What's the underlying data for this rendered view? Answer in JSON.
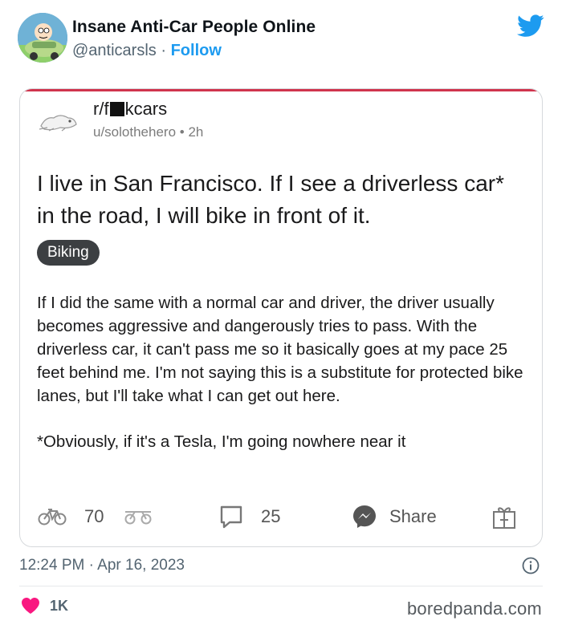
{
  "tweet": {
    "display_name": "Insane Anti-Car People Online",
    "handle": "@anticarsls",
    "separator": "·",
    "follow_label": "Follow",
    "avatar_icon": "cartoon-character-in-car-avatar",
    "platform_icon": "twitter-bird-icon",
    "timestamp": "12:24 PM · Apr 16, 2023",
    "like_count": "1K",
    "like_icon": "heart-icon",
    "info_icon": "info-icon"
  },
  "embedded_post": {
    "subreddit_prefix": "r/f",
    "subreddit_suffix": "kcars",
    "user": "u/solothehero",
    "dot": "•",
    "age": "2h",
    "title": "I live in San Francisco. If I see a driverless car* in the road, I will bike in front of it.",
    "flair": "Biking",
    "paragraphs": [
      "If I did the same with a normal car and driver, the driver usually becomes aggressive and dangerously tries to pass. With the driverless car, it can't pass me so it basically goes at my pace 25 feet behind me. I'm not saying this is a substitute for protected bike lanes, but I'll take what I can get out here.",
      "*Obviously, if it's a Tesla, I'm going nowhere near it"
    ],
    "upvote_count": "70",
    "comment_count": "25",
    "share_label": "Share",
    "icons": [
      "bicycle-vote-icon",
      "downvote-icon",
      "comment-icon",
      "messenger-share-icon",
      "gift-award-icon"
    ]
  },
  "watermark": "boredpanda.com",
  "colors": {
    "twitter_blue": "#1d9bf0",
    "text_primary": "#0f1419",
    "text_secondary": "#536471",
    "like_pink": "#f91880",
    "flair_bg": "#3c3f42"
  }
}
